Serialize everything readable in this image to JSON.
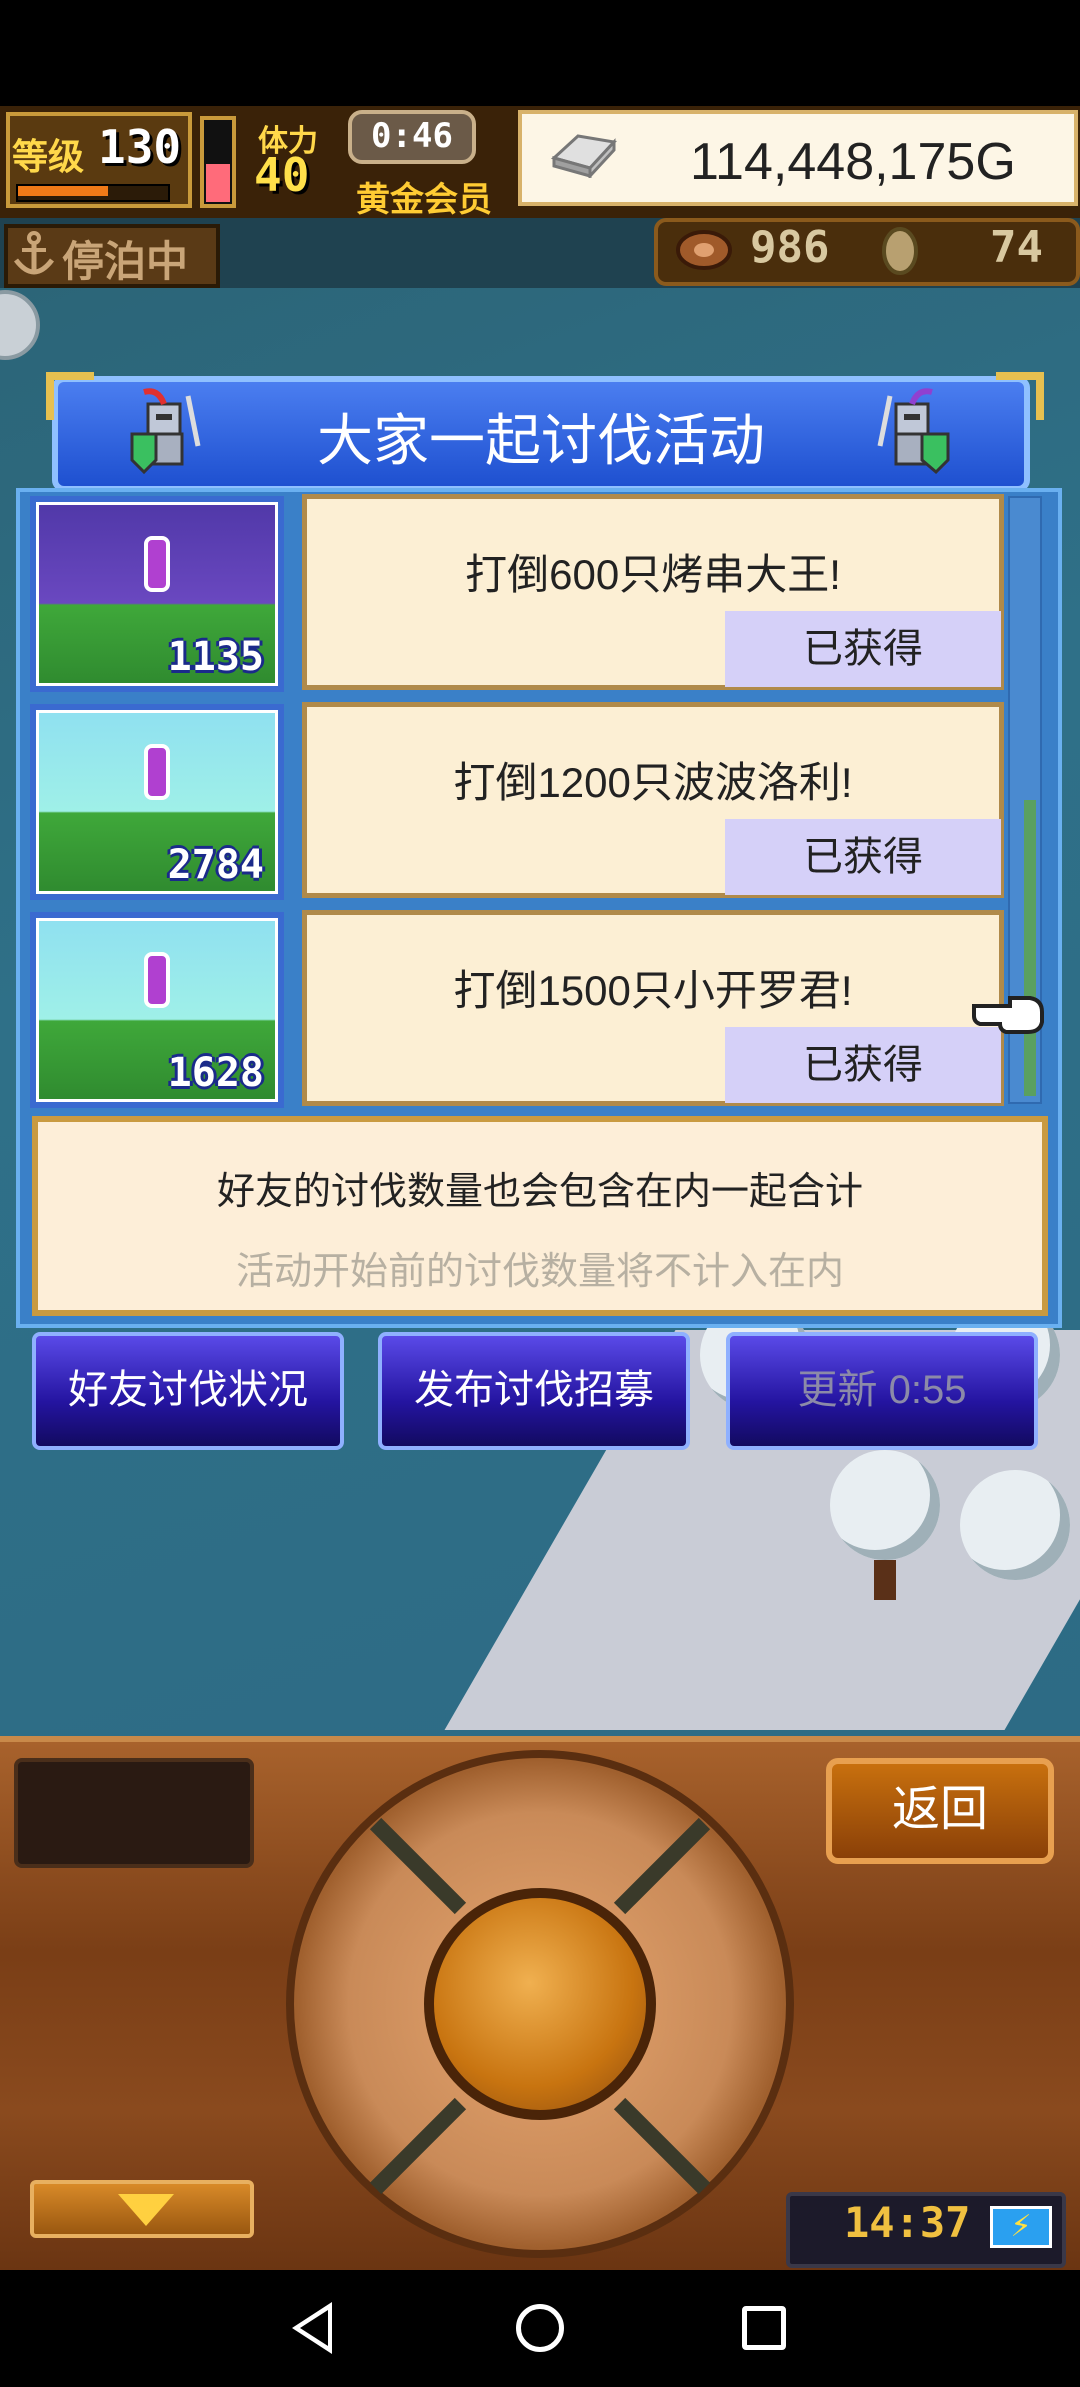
{
  "hud": {
    "level_label": "等级",
    "level": "130",
    "exp_fraction": 0.6,
    "stamina_fraction": 0.45,
    "vip_label": "体力",
    "vip_value": "40",
    "timer": "0:46",
    "member_label": "黄金会员",
    "gold": "114,448,175G",
    "docked_label": "停泊中",
    "resource1": "986",
    "resource2": "74"
  },
  "event": {
    "title": "大家一起讨伐活动",
    "items": [
      {
        "text": "打倒600只烤串大王!",
        "badge": "已获得",
        "count": "1135"
      },
      {
        "text": "打倒1200只波波洛利!",
        "badge": "已获得",
        "count": "2784"
      },
      {
        "text": "打倒1500只小开罗君!",
        "badge": "已获得",
        "count": "1628"
      }
    ],
    "note_line1": "好友的讨伐数量也会包含在内一起合计",
    "note_line2": "活动开始前的讨伐数量将不计入在内"
  },
  "buttons": {
    "friend_status": "好友讨伐状况",
    "post_recruit": "发布讨伐招募",
    "refresh": "更新 0:55"
  },
  "controls": {
    "back": "返回",
    "clock": "14:37"
  },
  "icons": {
    "battery": "battery-charging-icon",
    "gold": "silver-bar-icon",
    "anchor": "anchor-icon"
  }
}
